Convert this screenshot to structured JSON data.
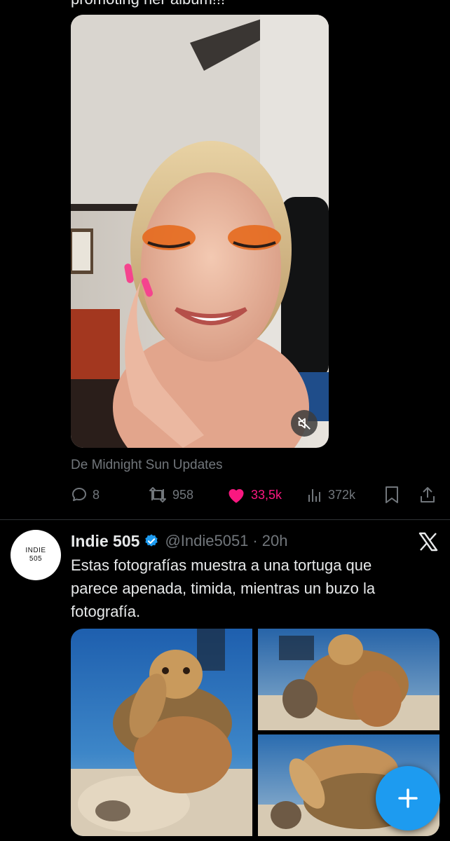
{
  "previous_tweet": {
    "truncated_text": "promoting her album!!!",
    "video": {
      "alt": "Video of a smiling woman with orange gem eye makeup",
      "muted": true
    },
    "source_label": "De Midnight Sun Updates",
    "actions": {
      "replies": "8",
      "retweets": "958",
      "likes": "33,5k",
      "views": "372k",
      "liked": true
    }
  },
  "tweet": {
    "avatar_text": "INDIE\n505",
    "name": "Indie 505",
    "verified": true,
    "handle": "@Indie5051",
    "separator": "·",
    "time": "20h",
    "text": "Estas fotografías muestra a una tortuga que parece apenada, timida, mientras un buzo la fotografía.",
    "photos": [
      {
        "alt": "Sea turtle covering its face with its flipper"
      },
      {
        "alt": "Sea turtle and diver"
      },
      {
        "alt": "Sea turtle close-up"
      }
    ]
  },
  "colors": {
    "background": "#000000",
    "text": "#e7e9ea",
    "muted": "#71767b",
    "like": "#f91880",
    "accent": "#1d9bf0",
    "divider": "#2f3336"
  },
  "icons": {
    "reply": "reply-icon",
    "retweet": "retweet-icon",
    "like": "heart-icon",
    "views": "views-icon",
    "bookmark": "bookmark-icon",
    "share": "share-icon",
    "mute": "mute-icon",
    "verified": "verified-badge-icon",
    "x": "x-logo-icon",
    "compose": "plus-icon"
  }
}
